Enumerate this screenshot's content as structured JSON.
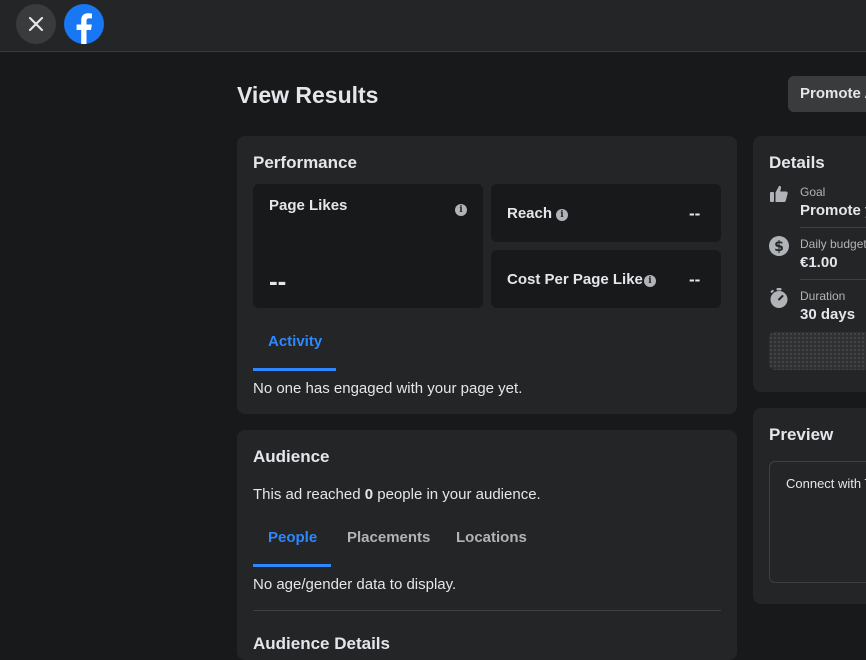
{
  "topbar": {
    "close_icon": "close-icon",
    "logo_icon": "facebook-logo-icon"
  },
  "page": {
    "title": "View Results",
    "promote_button": "Promote A"
  },
  "performance": {
    "title": "Performance",
    "page_likes": {
      "label": "Page Likes",
      "value": "--"
    },
    "reach": {
      "label": "Reach",
      "value": "--"
    },
    "cost_per_like": {
      "label": "Cost Per Page Like",
      "value": "--"
    },
    "tabs": [
      {
        "label": "Activity",
        "active": true
      }
    ],
    "activity_text": "No one has engaged with your page yet."
  },
  "audience": {
    "title": "Audience",
    "summary_prefix": "This ad reached ",
    "summary_count": "0",
    "summary_suffix": " people in your audience.",
    "tabs": [
      {
        "label": "People",
        "active": true
      },
      {
        "label": "Placements",
        "active": false
      },
      {
        "label": "Locations",
        "active": false
      }
    ],
    "empty_text": "No age/gender data to display.",
    "details_title": "Audience Details"
  },
  "details": {
    "title": "Details",
    "items": [
      {
        "icon": "thumbs-up-icon",
        "label": "Goal",
        "value": "Promote y"
      },
      {
        "icon": "dollar-icon",
        "label": "Daily budget",
        "value": "€1.00"
      },
      {
        "icon": "stopwatch-icon",
        "label": "Duration",
        "value": "30 days"
      }
    ]
  },
  "preview": {
    "title": "Preview",
    "text": "Connect with T"
  },
  "colors": {
    "accent": "#2d88ff",
    "background": "#18191a",
    "card": "#242526"
  }
}
